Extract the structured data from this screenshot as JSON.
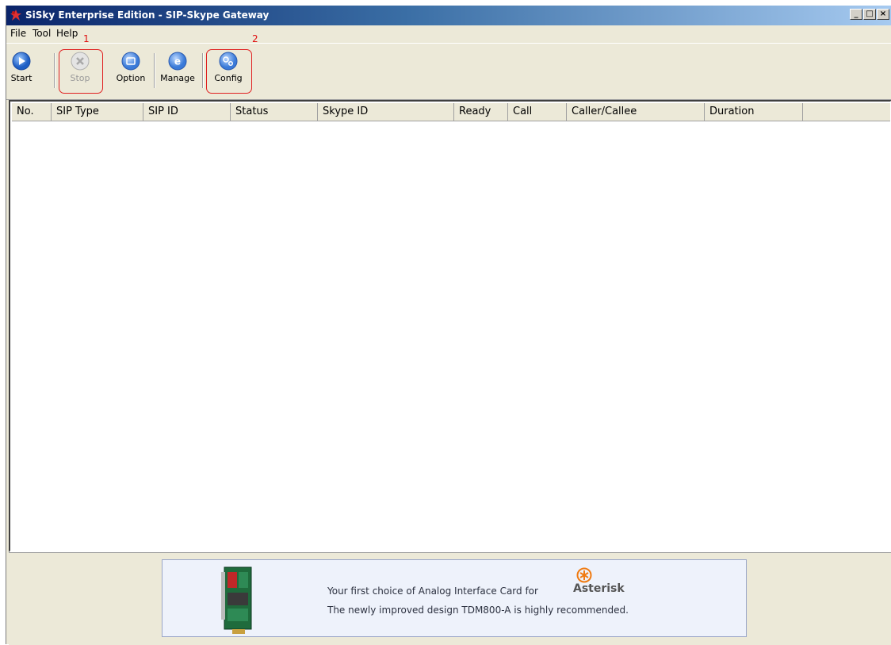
{
  "window": {
    "title": "SiSky Enterprise Edition - SIP-Skype Gateway"
  },
  "menu": [
    "File",
    "Tool",
    "Help"
  ],
  "annotations": [
    "1",
    "2"
  ],
  "toolbar": {
    "start": "Start",
    "stop": "Stop",
    "option": "Option",
    "manage": "Manage",
    "config": "Config"
  },
  "columns": [
    "No.",
    "SIP Type",
    "SIP ID",
    "Status",
    "Skype ID",
    "Ready",
    "Call",
    "Caller/Callee",
    "Duration"
  ],
  "banner": {
    "line1": "Your first choice of Analog Interface Card for",
    "brand": "Asterisk",
    "line2": "The newly improved design TDM800-A is highly recommended."
  },
  "colors": {
    "titlebar_start": "#0a246a",
    "titlebar_end": "#a6caf0",
    "annotation": "#e01010",
    "button_blue": "#2f6fd0"
  }
}
